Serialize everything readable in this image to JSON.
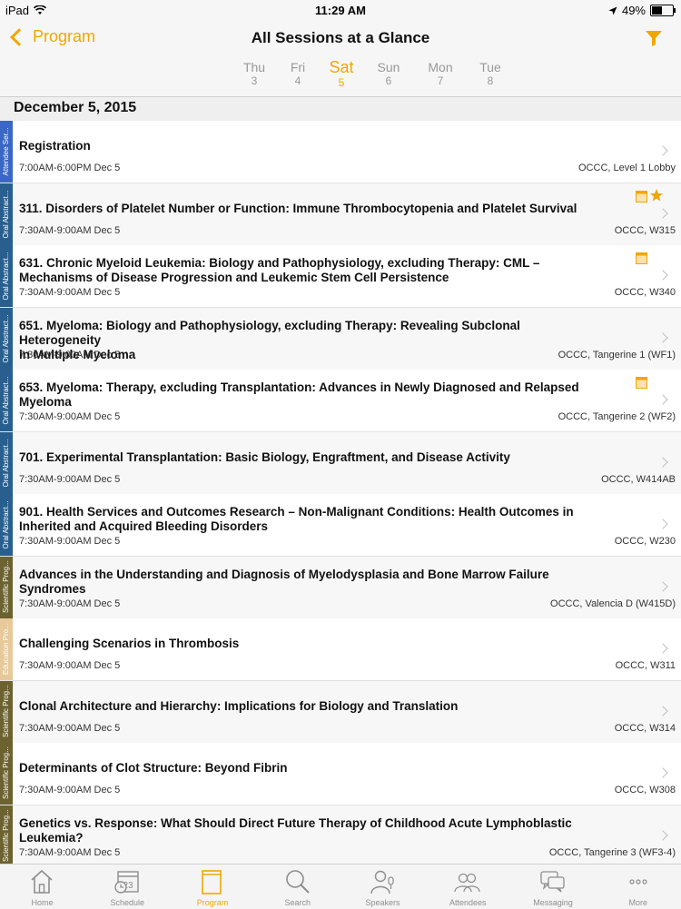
{
  "status": {
    "device": "iPad",
    "time": "11:29 AM",
    "battery": "49%"
  },
  "nav": {
    "back_label": "Program",
    "title": "All Sessions at a Glance"
  },
  "days": [
    {
      "name": "Thu",
      "num": "3"
    },
    {
      "name": "Fri",
      "num": "4"
    },
    {
      "name": "Sat",
      "num": "5"
    },
    {
      "name": "Sun",
      "num": "6"
    },
    {
      "name": "Mon",
      "num": "7"
    },
    {
      "name": "Tue",
      "num": "8"
    }
  ],
  "selected_day": "Sat",
  "date_header": "December 5, 2015",
  "colors": {
    "accent": "#f0a800",
    "attendee": "#3a67c4",
    "oral": "#285f8f",
    "scientific": "#6b6230",
    "education": "#e7c99a"
  },
  "sessions": [
    {
      "category": "Attendee Ser...",
      "cat_color": "#3a67c4",
      "title_lines": [
        "Registration"
      ],
      "time": "7:00AM-6:00PM  Dec 5",
      "location": "OCCC, Level 1 Lobby",
      "calendar": false,
      "starred": false
    },
    {
      "category": "Oral Abstract...",
      "cat_color": "#285f8f",
      "title_lines": [
        "311. Disorders of Platelet Number or Function: Immune Thrombocytopenia and Platelet Survival"
      ],
      "time": "7:30AM-9:00AM  Dec 5",
      "location": "OCCC, W315",
      "calendar": true,
      "starred": true
    },
    {
      "category": "Oral Abstract...",
      "cat_color": "#285f8f",
      "title_lines": [
        "631. Chronic Myeloid Leukemia: Biology and Pathophysiology, excluding Therapy: CML –",
        "Mechanisms of Disease Progression and Leukemic Stem Cell Persistence"
      ],
      "time": "7:30AM-9:00AM  Dec 5",
      "location": "OCCC, W340",
      "calendar": true,
      "starred": false
    },
    {
      "category": "Oral Abstract...",
      "cat_color": "#285f8f",
      "title_lines": [
        "651. Myeloma: Biology and Pathophysiology, excluding Therapy: Revealing Subclonal Heterogeneity",
        "in Multiple Myeloma"
      ],
      "time": "7:30AM-9:00AM  Dec 5",
      "location": "OCCC, Tangerine 1 (WF1)",
      "calendar": false,
      "starred": false
    },
    {
      "category": "Oral Abstract...",
      "cat_color": "#285f8f",
      "title_lines": [
        "653. Myeloma: Therapy, excluding Transplantation: Advances in Newly Diagnosed and Relapsed",
        "Myeloma"
      ],
      "time": "7:30AM-9:00AM  Dec 5",
      "location": "OCCC, Tangerine 2 (WF2)",
      "calendar": true,
      "starred": false
    },
    {
      "category": "Oral Abstract...",
      "cat_color": "#285f8f",
      "title_lines": [
        "701. Experimental Transplantation: Basic Biology, Engraftment, and Disease Activity"
      ],
      "time": "7:30AM-9:00AM  Dec 5",
      "location": "OCCC, W414AB",
      "calendar": false,
      "starred": false
    },
    {
      "category": "Oral Abstract...",
      "cat_color": "#285f8f",
      "title_lines": [
        "901. Health Services and Outcomes Research – Non-Malignant Conditions: Health Outcomes in",
        "Inherited and Acquired Bleeding Disorders"
      ],
      "time": "7:30AM-9:00AM  Dec 5",
      "location": "OCCC, W230",
      "calendar": false,
      "starred": false
    },
    {
      "category": "Scientific Prog...",
      "cat_color": "#6b6230",
      "title_lines": [
        "Advances in the Understanding and Diagnosis of Myelodysplasia and Bone Marrow Failure",
        "Syndromes"
      ],
      "time": "7:30AM-9:00AM  Dec 5",
      "location": "OCCC, Valencia D (W415D)",
      "calendar": false,
      "starred": false
    },
    {
      "category": "Education Pro...",
      "cat_color": "#e7c99a",
      "title_lines": [
        "Challenging Scenarios in Thrombosis"
      ],
      "time": "7:30AM-9:00AM  Dec 5",
      "location": "OCCC, W311",
      "calendar": false,
      "starred": false
    },
    {
      "category": "Scientific Prog...",
      "cat_color": "#6b6230",
      "title_lines": [
        "Clonal Architecture and Hierarchy: Implications  for Biology and Translation"
      ],
      "time": "7:30AM-9:00AM  Dec 5",
      "location": "OCCC, W314",
      "calendar": false,
      "starred": false
    },
    {
      "category": "Scientific Prog...",
      "cat_color": "#6b6230",
      "title_lines": [
        "Determinants of Clot Structure: Beyond Fibrin"
      ],
      "time": "7:30AM-9:00AM  Dec 5",
      "location": "OCCC, W308",
      "calendar": false,
      "starred": false
    },
    {
      "category": "Scientific Prog...",
      "cat_color": "#6b6230",
      "title_lines": [
        "Genetics vs. Response: What Should Direct Future Therapy of Childhood Acute Lymphoblastic",
        "Leukemia?"
      ],
      "time": "7:30AM-9:00AM  Dec 5",
      "location": "OCCC, Tangerine 3 (WF3-4)",
      "calendar": false,
      "starred": false
    }
  ],
  "tabs": [
    {
      "label": "Home",
      "icon": "home-icon"
    },
    {
      "label": "Schedule",
      "icon": "schedule-icon",
      "badge": "23"
    },
    {
      "label": "Program",
      "icon": "program-icon"
    },
    {
      "label": "Search",
      "icon": "search-icon"
    },
    {
      "label": "Speakers",
      "icon": "speakers-icon"
    },
    {
      "label": "Attendees",
      "icon": "attendees-icon"
    },
    {
      "label": "Messaging",
      "icon": "messaging-icon"
    },
    {
      "label": "More",
      "icon": "more-icon"
    }
  ],
  "active_tab": "Program"
}
